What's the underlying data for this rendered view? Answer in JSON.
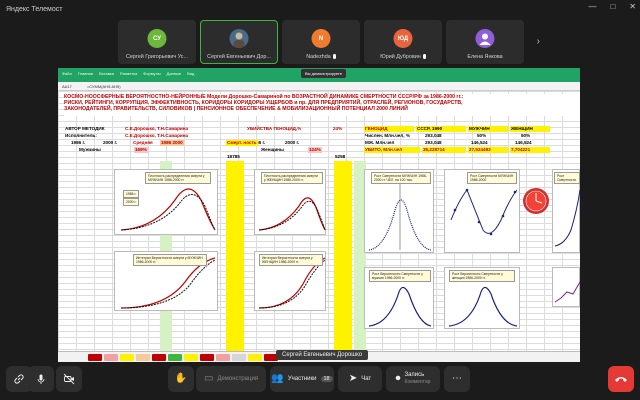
{
  "window": {
    "title": "Яндекс Телемост",
    "controls": [
      "—",
      "□",
      "✕"
    ]
  },
  "participants": [
    {
      "initials": "СУ",
      "name": "Сергей Григорьевич Ус...",
      "color": "#6bb83a",
      "active": false,
      "avatar_icon": "initials"
    },
    {
      "initials": "",
      "name": "Сергей Евгеньевич Дор...",
      "color": "#4a6a8a",
      "active": true,
      "avatar_icon": "photo-avatar"
    },
    {
      "initials": "N",
      "name": "Nadezhda",
      "color": "#f07b2e",
      "active": false,
      "avatar_icon": "initials"
    },
    {
      "initials": "ЮД",
      "name": "Юрий Дубровин",
      "color": "#e8643c",
      "active": false,
      "avatar_icon": "initials"
    },
    {
      "initials": "",
      "name": "Елена Янкова",
      "color": "#8f5fd9",
      "active": false,
      "avatar_icon": "person-icon"
    }
  ],
  "screen": {
    "share_badge": "Вы демонстрируете",
    "formula_ref": "AA17",
    "formula": "=СУММ(AH5:AH5)",
    "banner": {
      "line1": "КОСМО-НООСФЕРНЫЕ ВЕРОЯТНОСТНО-НЕЙРОННЫЕ Модели Дорошко-Самариной по ВОЗРАСТНОЙ ДИНАМИКЕ СМЕРТНОСТИ СССР/РФ за 1986-2000 гг.:",
      "line2": "РИСКИ, РЕЙТИНГИ, КОРРУПЦИЯ, ЭФФЕКТИВНОСТЬ, КОРИДОРЫ КОРИДОРЫ УЩЕРБОВ и пр. ДЛЯ ПРЕДПРИЯТИЙ, ОТРАСЛЕЙ, РЕГИОНОВ, ГОСУДАРСТВ,",
      "line3": "ЗАКОНОДАТЕЛЕЙ, ПРАВИТЕЛЬСТВ, СИЛОВИКОВ | ПЕНСИОННОЕ ОБЕСПЕЧЕНИЕ & МОБИЛИЗАЦИОННЫЙ ПОТЕНЦИАЛ 2000 ЛИНИЙ"
    },
    "row1": {
      "authors_label": "АВТОР МЕТОДИК",
      "authors": "С.Е.Дорошко, Т.Н.Самарина",
      "killed_label": "УБИЙСТВА ГЕНОЦИД,%",
      "killed_pct": "24%",
      "genocide": "ГЕНОЦИД",
      "ussr": "СССР, 1990",
      "men": "МУЖЧИН",
      "women": "ЖЕНЩИН"
    },
    "row2": {
      "exec_label": "Исполнитель:",
      "authors2": "С.Е.Дорошко, Т.Н.Самарина",
      "numbers_label": "Числен. Млн.чел, %",
      "total": "293,048",
      "men_pct": "50%",
      "women_pct": "50%"
    },
    "row3": {
      "year_from": "1986 г.",
      "year_to": "2000 г.",
      "avg_label": "Средняя",
      "years": "1986 2000",
      "year2": "1986 г.",
      "year3": "2000 г.",
      "mzh_label": "МЖ. Млн.чел",
      "total2": "293,048",
      "men_n": "146,524",
      "women_n": "146,524"
    },
    "row4": {
      "men_label": "Мужчины",
      "men_pct": "169%",
      "women_label": "Женщины",
      "women_pct": "124%",
      "killed_label": "УБИТО, Млн.чел",
      "killed": "35,228714",
      "killed_men": "27,524493",
      "killed_women": "7,704221"
    },
    "smert_label": "Смерт. ность",
    "num_18785": "18785",
    "num_5258": "5258",
    "chart_labels": [
      "Плотность распределения смерти у МУЖЧИН 1986-2000 гг.",
      "Плотность распределения смерти у ЖЕНЩИН 1986-2000 гг.",
      "Интеграл Вероятности смерти у МУЖЧИН 1986-2000 гг.",
      "Интеграл Вероятности смерти у ЖЕНЩИН 1986-2000 гг.",
      "Рост Смертности МУЖЧИН 1986-2000 гг. ЧЕЛ. на 100 тыс.",
      "Рост Вероятности Смертности у мужчин 1986-2000 гг.",
      "Рост Вероятности Смертности у женщин 1986-2000 гг.",
      "Рост Смертности МУЖЧИН 1986-2000",
      "Рост Смертности"
    ],
    "legend_1986": "1986 г.",
    "legend_2000": "2000 г."
  },
  "presenter": "Сергей Евгеньевич Дорошко",
  "toolbar": {
    "link_icon": "link-icon",
    "mic_icon": "microphone-icon",
    "camera_icon": "camera-off-icon",
    "hand_icon": "raise-hand-icon",
    "demo_label": "Демонстрация",
    "participants_label": "Участники",
    "participants_count": "18",
    "chat_label": "Чат",
    "record_label": "Запись",
    "record_sub": "Комментар",
    "more_icon": "more-icon",
    "end_icon": "end-call-icon"
  }
}
